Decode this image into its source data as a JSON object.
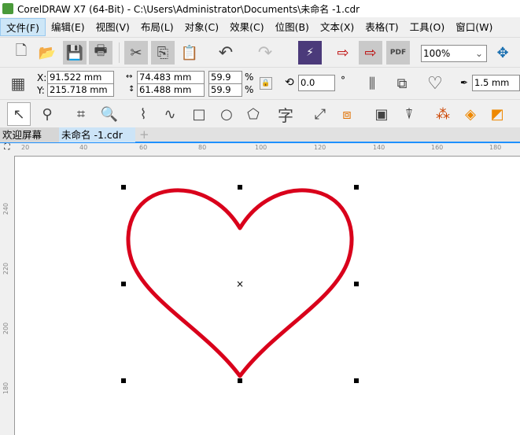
{
  "title": "CorelDRAW X7 (64-Bit) - C:\\Users\\Administrator\\Documents\\未命名 -1.cdr",
  "menu": [
    "文件(F)",
    "编辑(E)",
    "视图(V)",
    "布局(L)",
    "对象(C)",
    "效果(C)",
    "位图(B)",
    "文本(X)",
    "表格(T)",
    "工具(O)",
    "窗口(W)"
  ],
  "toolbar": {
    "zoom": "100%"
  },
  "props": {
    "x_label": "X:",
    "x": "91.522 mm",
    "y_label": "Y:",
    "y": "215.718 mm",
    "w": "74.483 mm",
    "h": "61.488 mm",
    "sx": "59.9",
    "sy": "59.9",
    "pct": "%",
    "angle": "0.0",
    "deg": "°",
    "outline": "1.5 mm"
  },
  "toolbox": {
    "text_tool": "字"
  },
  "tabs": {
    "welcome": "欢迎屏幕",
    "doc": "未命名 -1.cdr",
    "add": "+"
  },
  "ruler_h": [
    "20",
    "40",
    "60",
    "80",
    "100",
    "120",
    "140",
    "160",
    "180"
  ],
  "ruler_v": [
    "240",
    "220",
    "200",
    "180"
  ],
  "colors": {
    "heart": "#d9001b"
  }
}
